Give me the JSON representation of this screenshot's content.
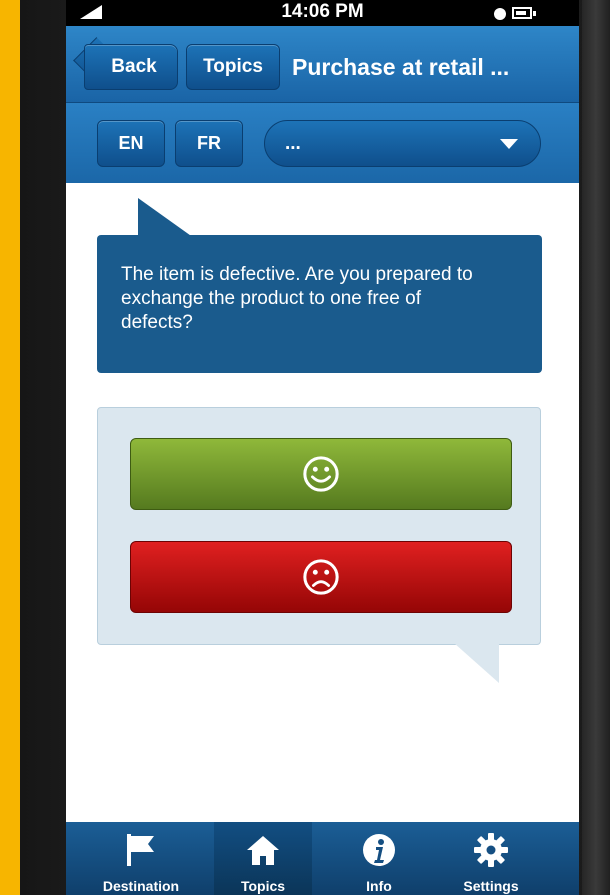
{
  "status_bar": {
    "time": "14:06 PM"
  },
  "header": {
    "back_label": "Back",
    "topics_label": "Topics",
    "title": "Purchase at retail ..."
  },
  "language_bar": {
    "en_label": "EN",
    "fr_label": "FR",
    "select_value": "..."
  },
  "question": {
    "text": "The item is defective. Are you prepared to exchange the product to one free of defects?"
  },
  "answers": {
    "yes_icon": "smiley-face-icon",
    "no_icon": "frowning-face-icon"
  },
  "tabs": [
    {
      "label": "Destination",
      "icon": "flag-icon"
    },
    {
      "label": "Topics",
      "icon": "home-icon"
    },
    {
      "label": "Info",
      "icon": "info-icon"
    },
    {
      "label": "Settings",
      "icon": "gear-icon"
    }
  ],
  "colors": {
    "accent_yellow": "#f7b500",
    "header_blue": "#1a64a6",
    "yes_green": "#6b9a2a",
    "no_red": "#c30b0b"
  }
}
